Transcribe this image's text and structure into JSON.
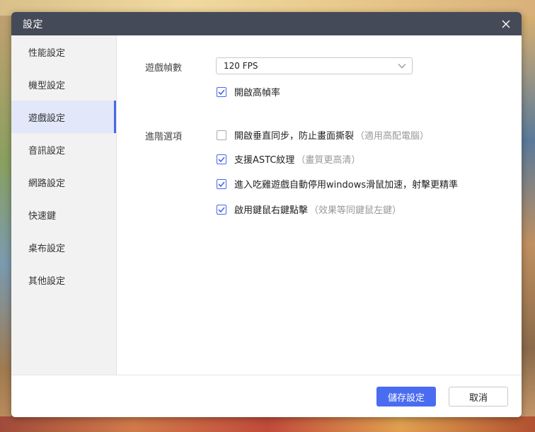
{
  "window": {
    "title": "設定"
  },
  "sidebar": {
    "items": [
      {
        "label": "性能設定",
        "active": false
      },
      {
        "label": "機型設定",
        "active": false
      },
      {
        "label": "遊戲設定",
        "active": true
      },
      {
        "label": "音訊設定",
        "active": false
      },
      {
        "label": "網路設定",
        "active": false
      },
      {
        "label": "快速鍵",
        "active": false
      },
      {
        "label": "桌布設定",
        "active": false
      },
      {
        "label": "其他設定",
        "active": false
      }
    ]
  },
  "frame_rate": {
    "label": "遊戲幀數",
    "selected": "120 FPS",
    "high_fps": {
      "label": "開啟高幀率",
      "checked": true
    }
  },
  "advanced": {
    "label": "進階選項",
    "options": [
      {
        "label": "開啟垂直同步，防止畫面撕裂",
        "hint": "（適用高配電腦）",
        "checked": false
      },
      {
        "label": "支援ASTC紋理",
        "hint": "（畫質更高清）",
        "checked": true
      },
      {
        "label": "進入吃雞遊戲自動停用windows滑鼠加速，射擊更精準",
        "hint": "",
        "checked": true
      },
      {
        "label": "啟用鍵鼠右鍵點擊",
        "hint": "（效果等同鍵鼠左鍵）",
        "checked": true
      }
    ]
  },
  "footer": {
    "save_label": "儲存設定",
    "cancel_label": "取消"
  },
  "colors": {
    "accent": "#4a67e8",
    "titlebar": "#454a58",
    "active_bg": "#e2e7fa"
  },
  "icons": {
    "close": "close-icon",
    "dropdown": "chevron-down-icon",
    "check": "check-icon"
  }
}
